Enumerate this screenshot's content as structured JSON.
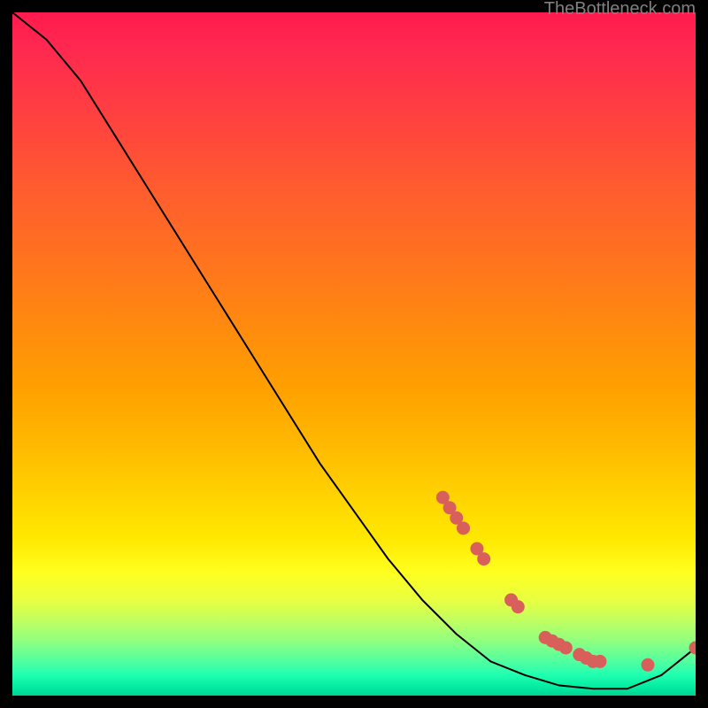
{
  "watermark": "TheBottleneck.com",
  "chart_data": {
    "type": "line",
    "title": "",
    "xlabel": "",
    "ylabel": "",
    "xlim": [
      0,
      100
    ],
    "ylim": [
      0,
      100
    ],
    "curve": {
      "x": [
        0,
        5,
        10,
        15,
        20,
        25,
        30,
        35,
        40,
        45,
        50,
        55,
        60,
        65,
        70,
        75,
        80,
        85,
        90,
        95,
        100
      ],
      "y": [
        100,
        96,
        90,
        82,
        74,
        66,
        58,
        50,
        42,
        34,
        27,
        20,
        14,
        9,
        5,
        3,
        1.5,
        1,
        1,
        3,
        7
      ]
    },
    "highlighted_points": {
      "x": [
        63,
        64,
        65,
        66,
        68,
        69,
        73,
        74,
        78,
        79,
        80,
        81,
        83,
        84,
        85,
        86,
        93,
        100
      ],
      "y": [
        29,
        27.5,
        26,
        24.5,
        21.5,
        20,
        14,
        13,
        8.5,
        8,
        7.5,
        7,
        6,
        5.5,
        5,
        5,
        4.5,
        7
      ]
    },
    "gradient_colors": {
      "top": "#ff1a4d",
      "middle": "#ffd000",
      "bottom": "#00d090"
    }
  }
}
